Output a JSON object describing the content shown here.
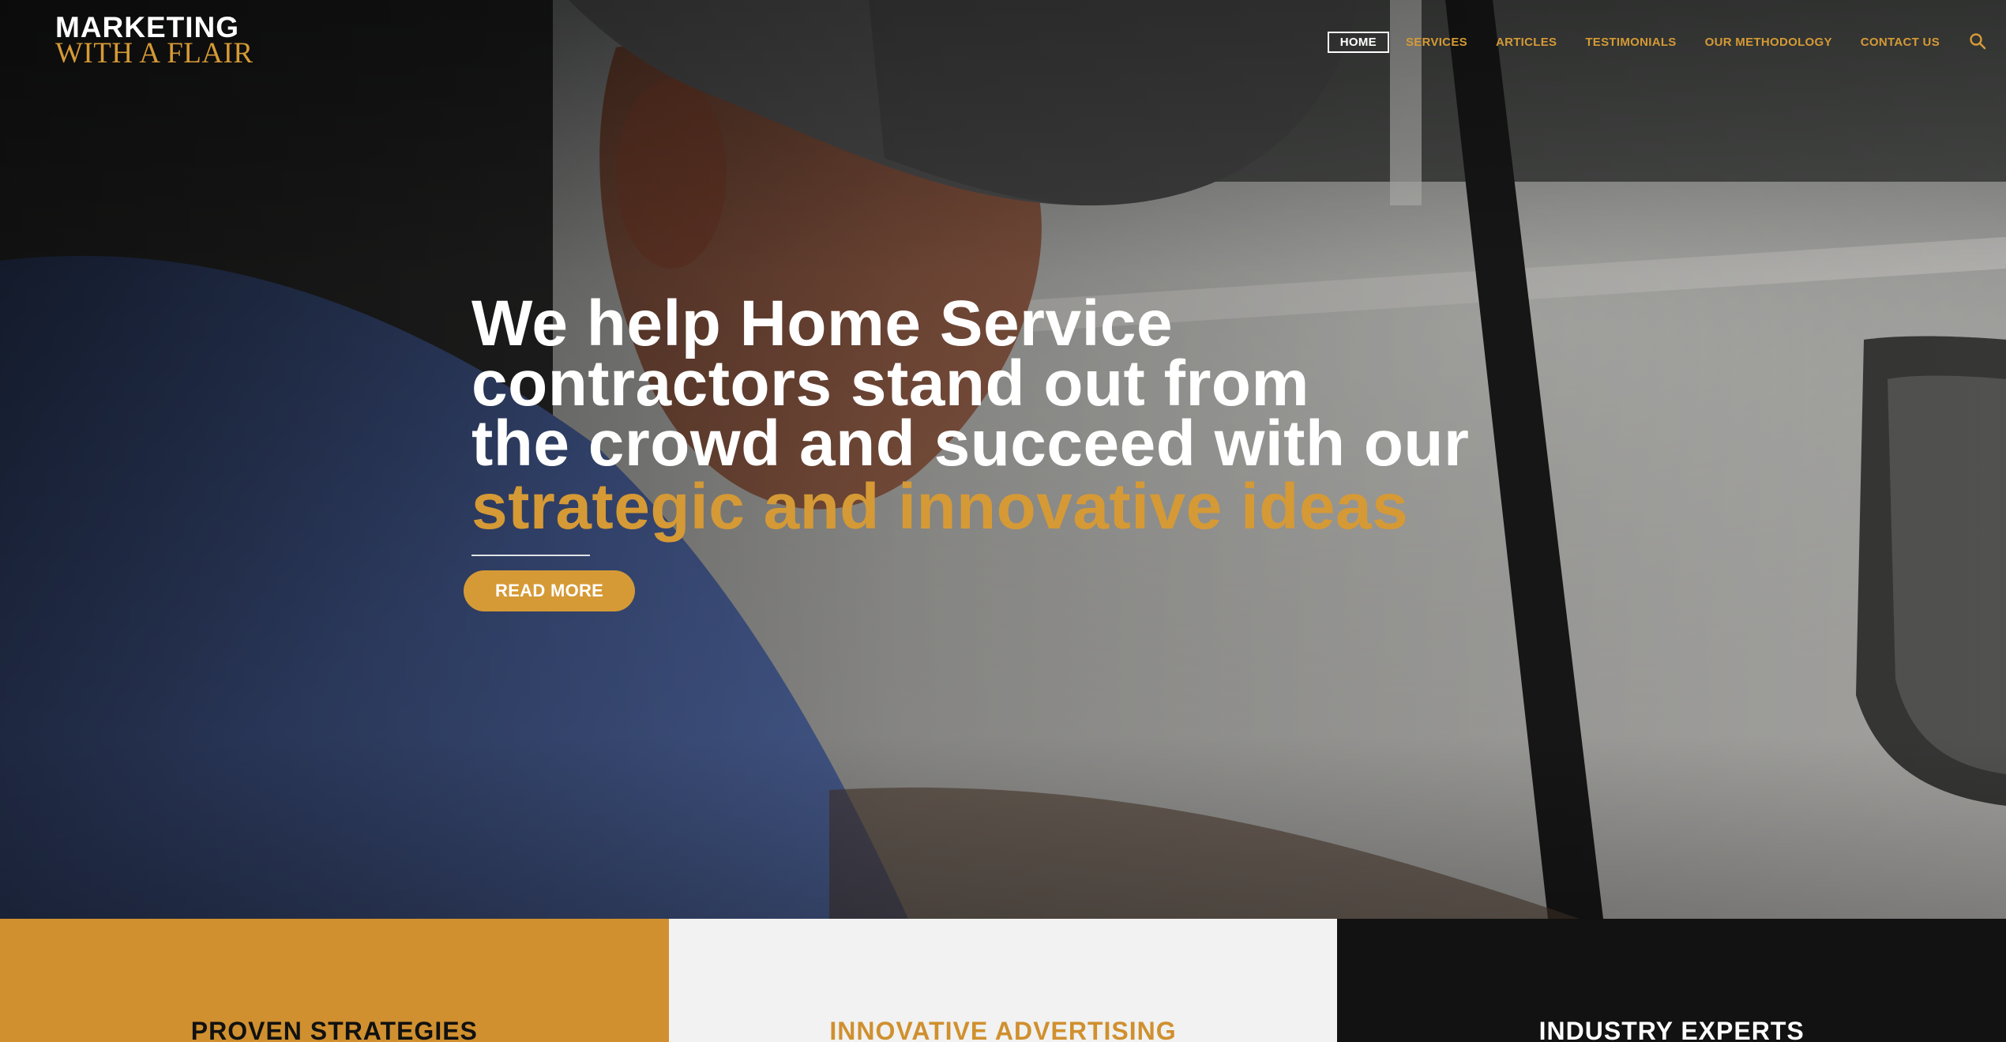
{
  "brand": {
    "line1": "MARKETING",
    "line2": "WITH A FLAIR",
    "primary_color": "#ffffff",
    "accent_color": "#d59a36"
  },
  "nav": {
    "items": [
      {
        "label": "HOME",
        "active": true
      },
      {
        "label": "SERVICES",
        "active": false
      },
      {
        "label": "ARTICLES",
        "active": false
      },
      {
        "label": "TESTIMONIALS",
        "active": false
      },
      {
        "label": "OUR METHODOLOGY",
        "active": false
      },
      {
        "label": "CONTACT US",
        "active": false
      }
    ],
    "search_icon": "search-icon"
  },
  "hero": {
    "headline_lines": [
      "We help Home Service",
      "contractors stand out from",
      "the crowd and succeed with our"
    ],
    "headline_accent": "strategic and innovative ideas",
    "cta_label": "READ MORE",
    "cta_color": "#d59a36"
  },
  "features": [
    {
      "title": "PROVEN STRATEGIES",
      "bg": "#d0902f",
      "color": "#111111"
    },
    {
      "title": "INNOVATIVE ADVERTISING",
      "bg": "#f1f2f1",
      "color": "#d0902f"
    },
    {
      "title": "INDUSTRY EXPERTS",
      "bg": "#121212",
      "color": "#ffffff"
    }
  ]
}
